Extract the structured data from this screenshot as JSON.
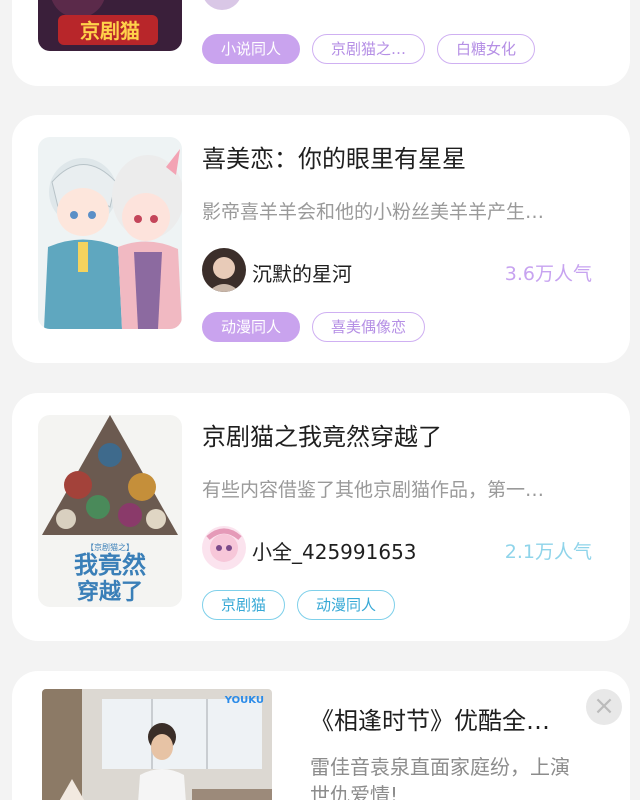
{
  "cards": [
    {
      "title": "",
      "author": "",
      "popularity": "",
      "tags": [
        "小说同人",
        "京剧猫之…",
        "白糖女化"
      ]
    },
    {
      "title": "喜美恋：你的眼里有星星",
      "description": "影帝喜羊羊会和他的小粉丝美羊羊产生…",
      "author": "沉默的星河",
      "popularity": "3.6万人气",
      "tags": [
        "动漫同人",
        "喜美偶像恋"
      ]
    },
    {
      "title": "京剧猫之我竟然穿越了",
      "description": "有些内容借鉴了其他京剧猫作品，第一…",
      "author": "小全_425991653",
      "popularity": "2.1万人气",
      "tags": [
        "京剧猫",
        "动漫同人"
      ],
      "cover_text": [
        "我竟然",
        "穿越了"
      ],
      "cover_small": "【京剧猫之】"
    }
  ],
  "ad": {
    "title": "《相逢时节》优酷全…",
    "description": "雷佳音袁泉直面家庭纷，上演世仇爱情!",
    "brand": "YOUKU",
    "close_label": "×"
  },
  "colors": {
    "accent_purple": "#c9a3ee",
    "accent_teal": "#7fd0ea",
    "background": "#f3f3f3"
  }
}
